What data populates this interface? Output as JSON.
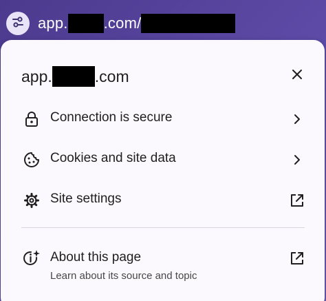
{
  "address_bar": {
    "url_prefix": "app.",
    "url_middle": ".com/",
    "tune_icon": "tune-icon"
  },
  "popup": {
    "title_prefix": "app.",
    "title_suffix": ".com",
    "close_icon": "close-icon",
    "items": [
      {
        "label": "Connection is secure",
        "icon": "lock-icon",
        "trail": "chevron-right-icon"
      },
      {
        "label": "Cookies and site data",
        "icon": "cookie-icon",
        "trail": "chevron-right-icon"
      },
      {
        "label": "Site settings",
        "icon": "gear-icon",
        "trail": "open-external-icon"
      }
    ],
    "about": {
      "label": "About this page",
      "sublabel": "Learn about its source and topic",
      "icon": "info-sparkle-icon",
      "trail": "open-external-icon"
    }
  },
  "colors": {
    "background": "#5c4aa6",
    "popup": "#fbf9fd",
    "text": "#1f1f1f"
  }
}
